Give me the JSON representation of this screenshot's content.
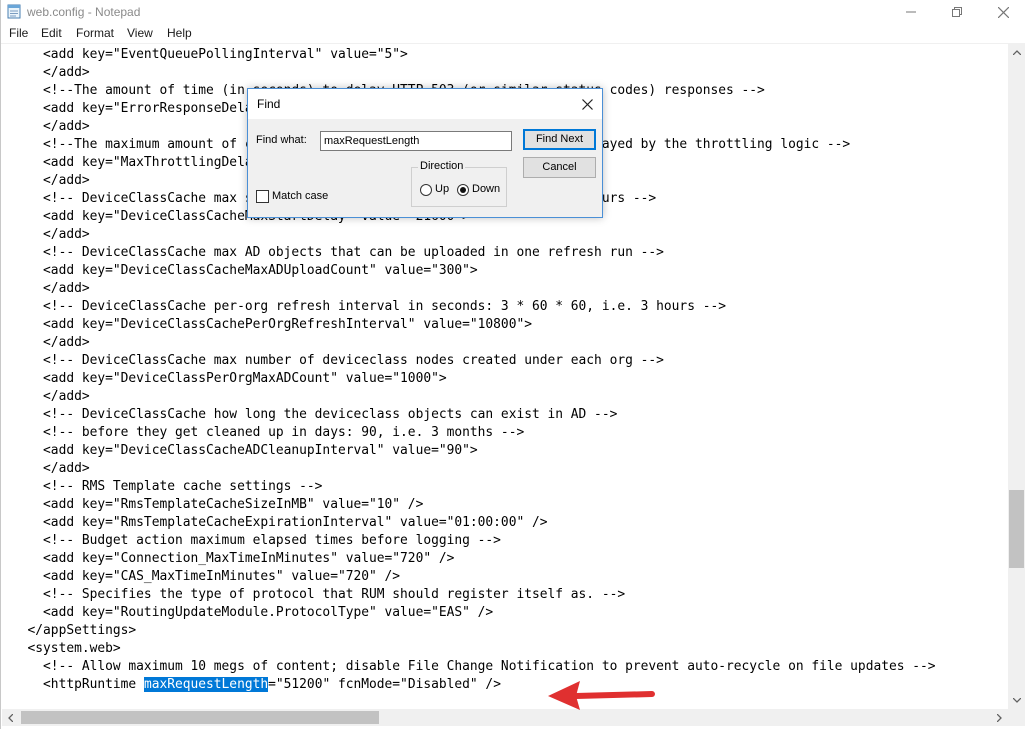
{
  "window": {
    "title": "web.config - Notepad"
  },
  "menu": [
    "File",
    "Edit",
    "Format",
    "View",
    "Help"
  ],
  "editor": {
    "lines": [
      "    <add key=\"EventQueuePollingInterval\" value=\"5\">",
      "    </add>",
      "    <!--The amount of time (in seconds) to delay HTTP 503 (or similar status codes) responses -->",
      "    <add key=\"ErrorResponseDelay\" value=\"5\">",
      "    </add>",
      "    <!--The maximum amount of concurrent requests that are allowed to be delayed by the throttling logic -->",
      "    <add key=\"MaxThrottlingDelayCount\" value=\"50\">",
      "    </add>",
      "    <!-- DeviceClassCache max start delay in seconds: 6 * 60 * 60, i.e. 6 hours -->",
      "    <add key=\"DeviceClassCacheMaxStartDelay\" value=\"21600\">",
      "    </add>",
      "    <!-- DeviceClassCache max AD objects that can be uploaded in one refresh run -->",
      "    <add key=\"DeviceClassCacheMaxADUploadCount\" value=\"300\">",
      "    </add>",
      "    <!-- DeviceClassCache per-org refresh interval in seconds: 3 * 60 * 60, i.e. 3 hours -->",
      "    <add key=\"DeviceClassCachePerOrgRefreshInterval\" value=\"10800\">",
      "    </add>",
      "    <!-- DeviceClassCache max number of deviceclass nodes created under each org -->",
      "    <add key=\"DeviceClassPerOrgMaxADCount\" value=\"1000\">",
      "    </add>",
      "    <!-- DeviceClassCache how long the deviceclass objects can exist in AD -->",
      "    <!-- before they get cleaned up in days: 90, i.e. 3 months -->",
      "    <add key=\"DeviceClassCacheADCleanupInterval\" value=\"90\">",
      "    </add>",
      "    <!-- RMS Template cache settings -->",
      "    <add key=\"RmsTemplateCacheSizeInMB\" value=\"10\" />",
      "    <add key=\"RmsTemplateCacheExpirationInterval\" value=\"01:00:00\" />",
      "    <!-- Budget action maximum elapsed times before logging -->",
      "    <add key=\"Connection_MaxTimeInMinutes\" value=\"720\" />",
      "    <add key=\"CAS_MaxTimeInMinutes\" value=\"720\" />",
      "    <!-- Specifies the type of protocol that RUM should register itself as. -->",
      "    <add key=\"RoutingUpdateModule.ProtocolType\" value=\"EAS\" />",
      "  </appSettings>",
      "  <system.web>",
      "    <!-- Allow maximum 10 megs of content; disable File Change Notification to prevent auto-recycle on file updates -->"
    ],
    "last_line": {
      "before": "    <httpRuntime ",
      "selected": "maxRequestLength",
      "after": "=\"51200\" fcnMode=\"Disabled\" />"
    }
  },
  "find_dialog": {
    "title": "Find",
    "find_what_label": "Find what:",
    "find_what_value": "maxRequestLength",
    "find_next_label": "Find Next",
    "cancel_label": "Cancel",
    "direction_label": "Direction",
    "up_label": "Up",
    "down_label": "Down",
    "direction_selected": "Down",
    "match_case_label": "Match case",
    "match_case_checked": false
  },
  "colors": {
    "selection": "#0078d7",
    "annotation_arrow": "#e03030",
    "dialog_border": "#4a8fd6"
  }
}
